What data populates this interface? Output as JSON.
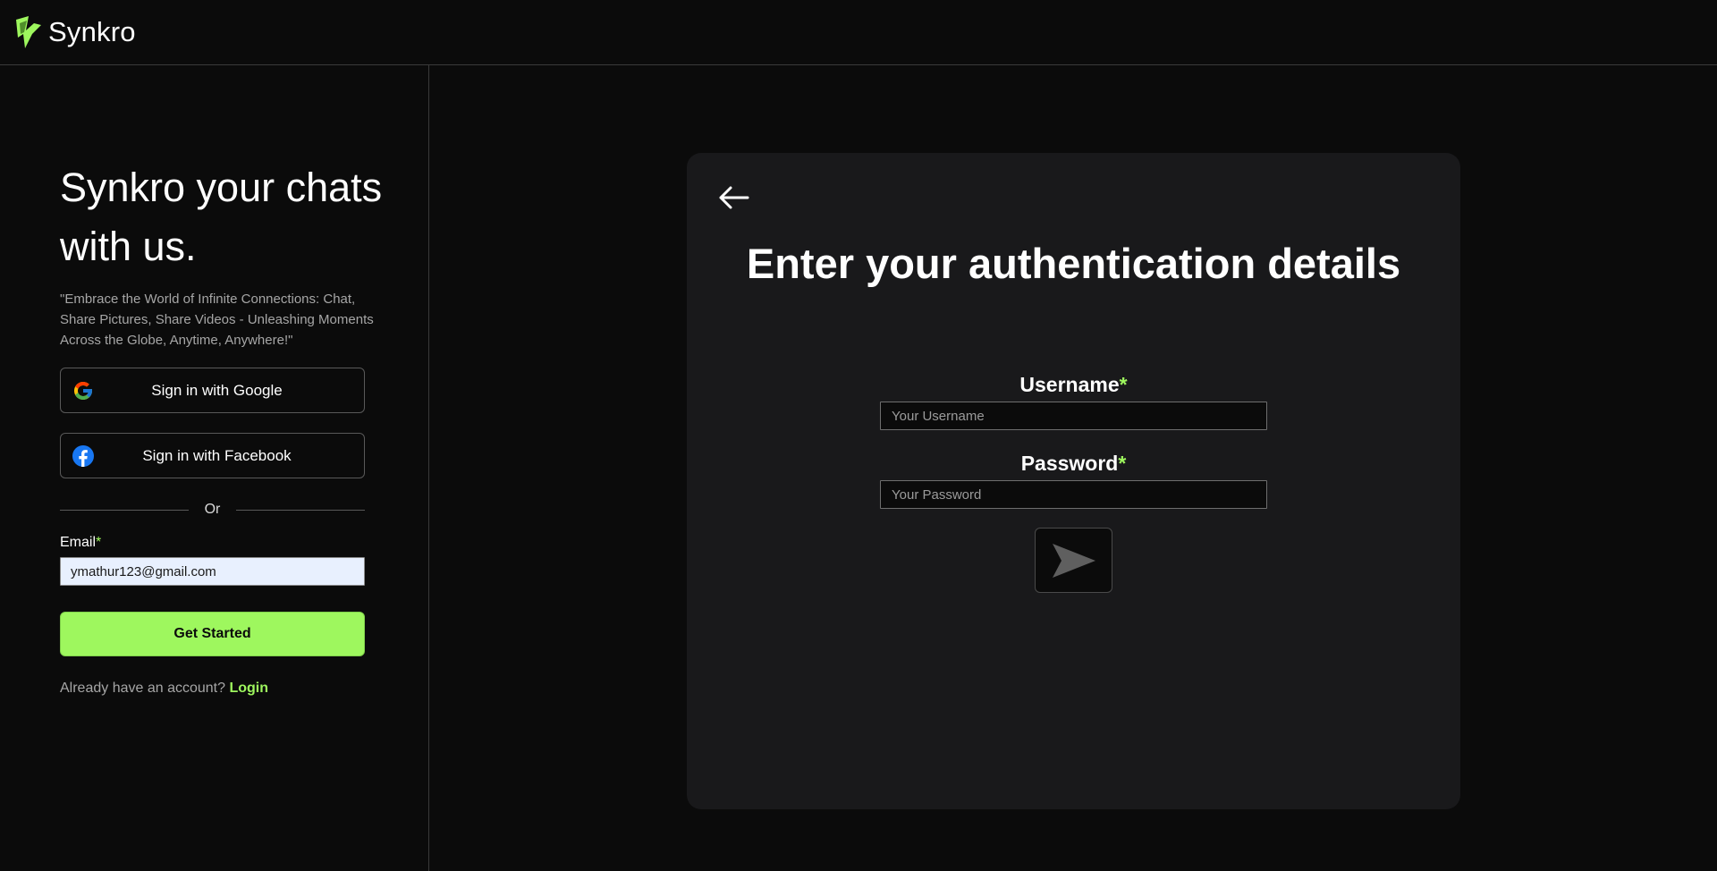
{
  "header": {
    "brand": "Synkro",
    "logo_icon": "synkro-logo-icon"
  },
  "sidebar": {
    "headline": "Synkro your chats with us.",
    "tagline": "\"Embrace the World of Infinite Connections: Chat, Share Pictures, Share Videos - Unleashing Moments Across the Globe, Anytime, Anywhere!\"",
    "google_label": "Sign in with Google",
    "google_icon": "google-icon",
    "facebook_label": "Sign in with Facebook",
    "facebook_icon": "facebook-icon",
    "divider_text": "Or",
    "email_label": "Email",
    "required_mark": "*",
    "email_value": "ymathur123@gmail.com",
    "cta_label": "Get Started",
    "login_prompt": "Already have an account?",
    "login_link": "Login"
  },
  "auth_card": {
    "back_icon": "arrow-left-icon",
    "title": "Enter your authentication details",
    "username_label": "Username",
    "username_placeholder": "Your Username",
    "password_label": "Password",
    "password_placeholder": "Your Password",
    "required_mark": "*",
    "submit_icon": "send-arrow-icon"
  },
  "colors": {
    "accent": "#9ef75e",
    "background": "#0b0b0b",
    "card_background": "#19191b",
    "muted_text": "#a6a6a6"
  }
}
